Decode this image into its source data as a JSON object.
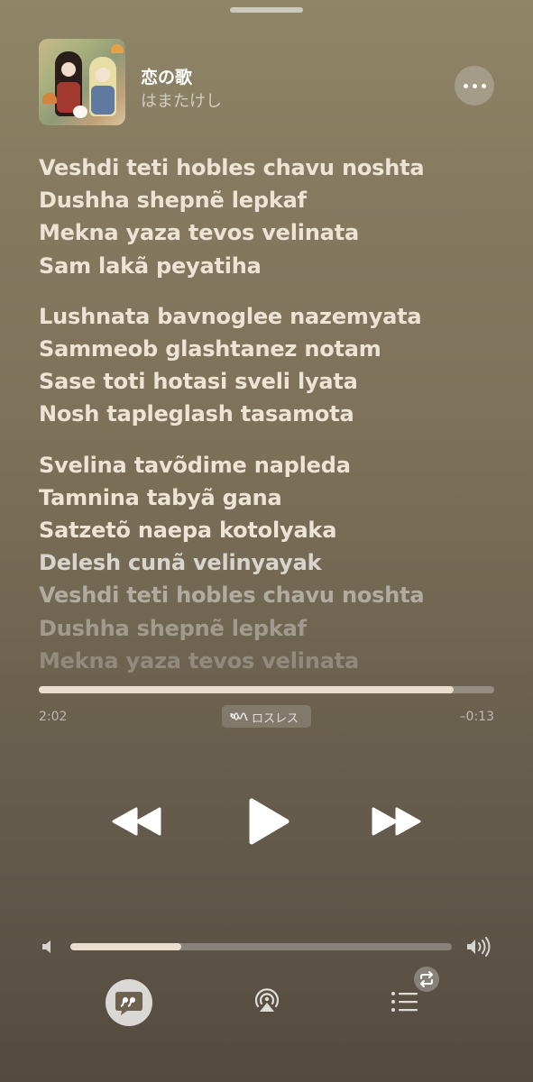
{
  "now_playing": {
    "title": "恋の歌",
    "artist": "はまたけし"
  },
  "lyrics": {
    "stanzas": [
      [
        "Veshdi teti hobles chavu noshta",
        "Dushha shepnẽ lepkaf",
        "Mekna yaza tevos velinata",
        "Sam lakã peyatiha"
      ],
      [
        "Lushnata bavnoglee nazemyata",
        "Sammeob glashtanez notam",
        "Sase toti hotasi sveli lyata",
        "Nosh tapleglash tasamota"
      ],
      [
        "Svelina tavõdime napleda",
        "Tamnina tabyã gana",
        "Satzetõ naepa kotolyaka",
        "Delesh cunã velinyayak",
        "Veshdi teti hobles chavu noshta",
        "Dushha shepnẽ lepkaf",
        "Mekna yaza tevos velinata"
      ]
    ]
  },
  "playback": {
    "elapsed": "2:02",
    "remaining": "–0:13",
    "progress_fraction": 0.91,
    "quality_badge": "ロスレス",
    "volume_fraction": 0.29
  },
  "icons": {
    "more": "ellipsis-icon",
    "rewind": "rewind-icon",
    "play": "play-icon",
    "forward": "fast-forward-icon",
    "volume_low": "speaker-low-icon",
    "volume_high": "speaker-high-icon",
    "lyrics": "lyrics-quote-icon",
    "airplay": "airplay-icon",
    "queue": "queue-list-icon",
    "repeat": "repeat-icon",
    "lossless": "lossless-wave-icon"
  },
  "colors": {
    "background_top": "#8f8567",
    "background_bottom": "#544b3f",
    "progress_fill": "#eadfcf"
  }
}
